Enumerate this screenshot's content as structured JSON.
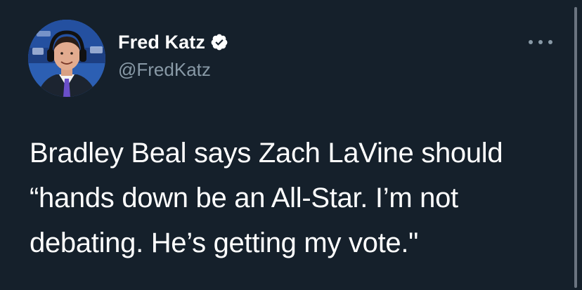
{
  "author": {
    "display_name": "Fred Katz",
    "handle": "@FredKatz",
    "verified": true,
    "avatar_icon": "profile-photo"
  },
  "tweet": {
    "lines": [
      "Bradley Beal says Zach LaVine should",
      "“hands down be an All-Star. I’m not",
      "debating. He’s getting my vote.\""
    ]
  },
  "menu_icon": "more-options-icon",
  "colors": {
    "background": "#15202b",
    "text_primary": "#ffffff",
    "text_secondary": "#8899a6",
    "verified_badge": "#ffffff"
  }
}
